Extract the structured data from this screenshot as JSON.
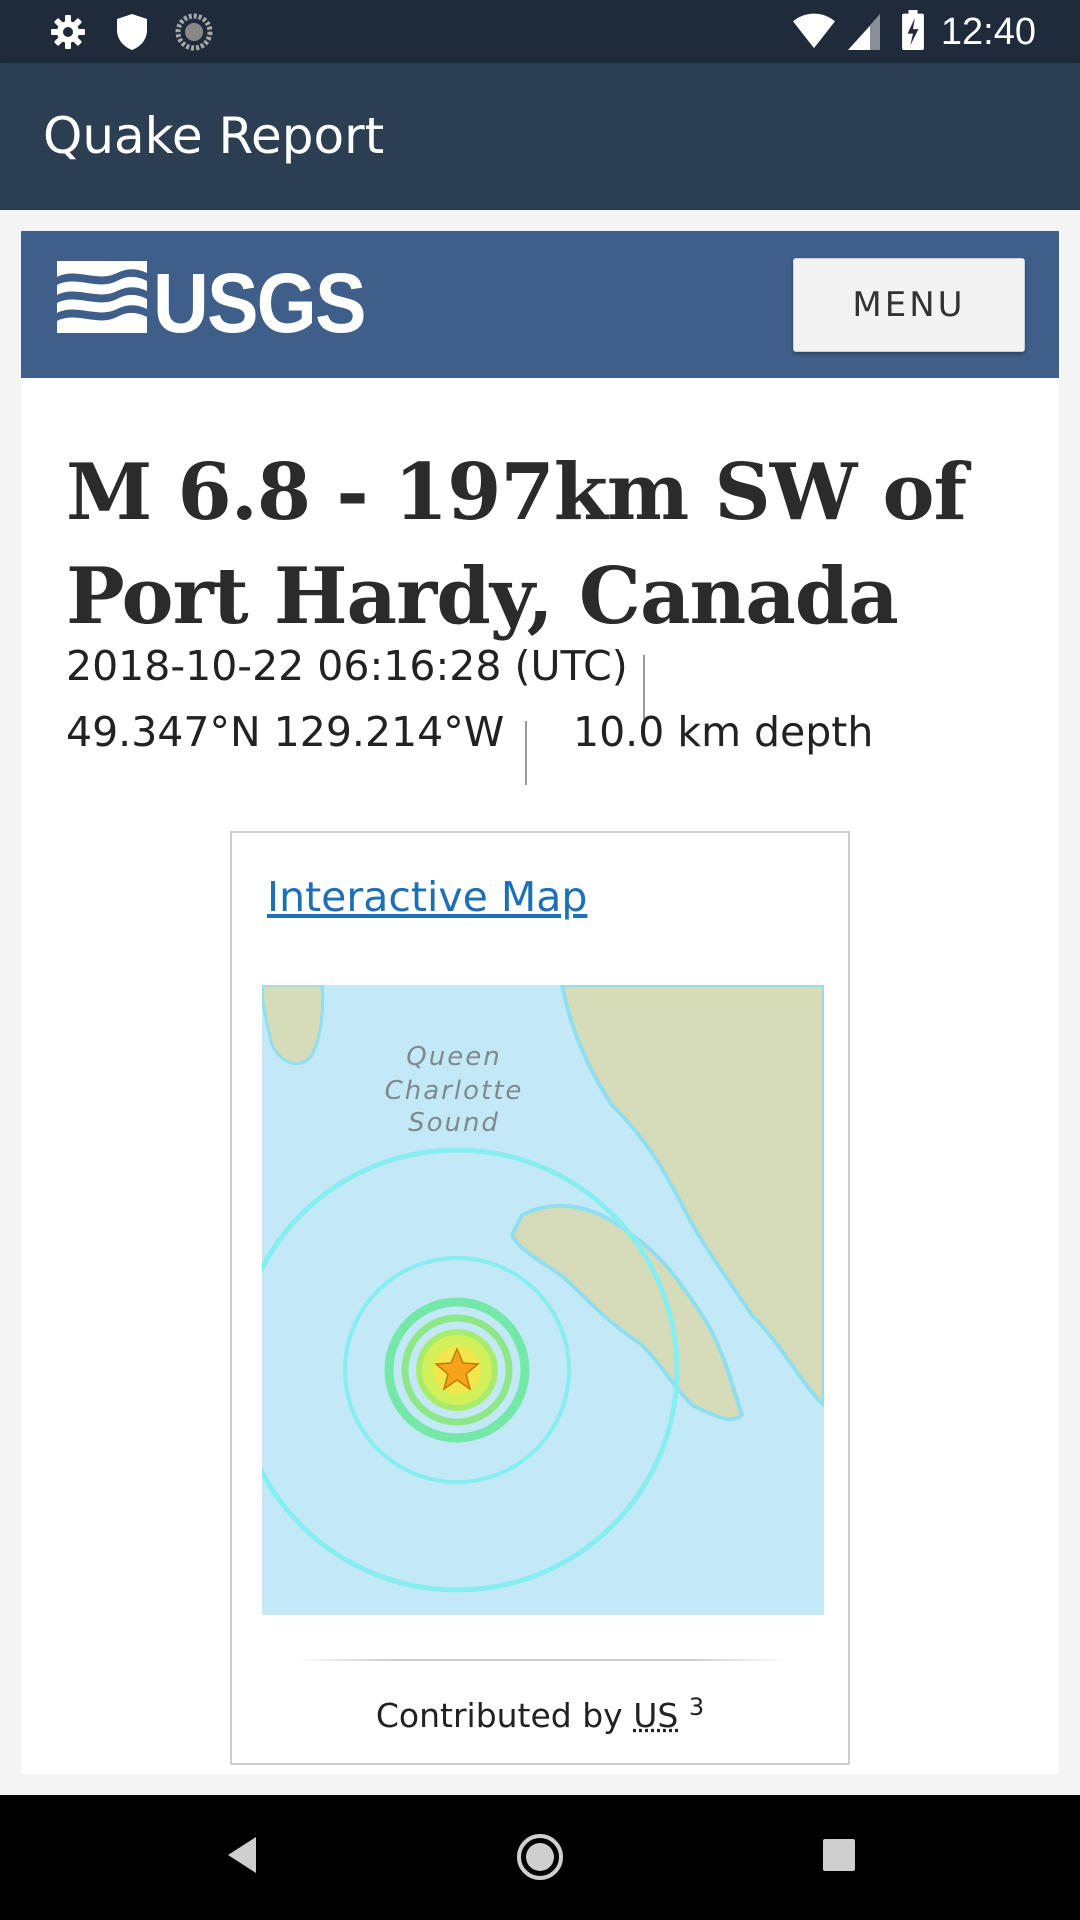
{
  "status_bar": {
    "time": "12:40",
    "left_icons": [
      "settings-icon",
      "shield-icon",
      "sync-icon"
    ],
    "right_icons": [
      "wifi-icon",
      "cell-signal-icon",
      "battery-charging-icon"
    ]
  },
  "app_bar": {
    "title": "Quake Report"
  },
  "usgs_header": {
    "logo_text": "USGS",
    "menu_label": "MENU"
  },
  "event": {
    "title": "M 6.8 - 197km SW of Port Hardy, Canada",
    "time": "2018-10-22 06:16:28 (UTC)",
    "location": "49.347°N 129.214°W",
    "depth": "10.0 km depth"
  },
  "map_card": {
    "link_label": "Interactive Map",
    "map_label_line1": "Queen",
    "map_label_line2": "Charlotte",
    "map_label_line3": "Sound",
    "contributed_prefix": "Contributed by",
    "network": "US",
    "superscript": "3"
  },
  "nav_bar": {
    "icons": [
      "back-icon",
      "home-icon",
      "recents-icon"
    ]
  },
  "colors": {
    "status_bar": "#1f2b3a",
    "app_bar": "#2c3e52",
    "usgs_header": "#3f5f8a",
    "link": "#1e6fb5",
    "ocean": "#c4e9f6",
    "land": "#d6dcb9"
  }
}
